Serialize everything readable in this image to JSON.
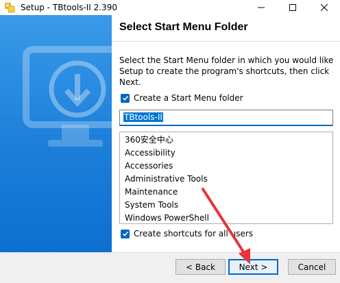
{
  "window": {
    "title": "Setup - TBtools-II 2.390"
  },
  "page": {
    "heading": "Select Start Menu Folder",
    "description_lines": [
      "Select the Start Menu folder in which you would like",
      "Setup to create the program's shortcuts, then click",
      "Next."
    ]
  },
  "create_folder": {
    "label": "Create a Start Menu folder",
    "checked": true
  },
  "folder_input": {
    "value": "TBtools-II"
  },
  "folder_list": [
    "360安全中心",
    "Accessibility",
    "Accessories",
    "Administrative Tools",
    "Maintenance",
    "System Tools",
    "Windows PowerShell"
  ],
  "all_users": {
    "label": "Create shortcuts for all users",
    "checked": true
  },
  "buttons": {
    "back": "< Back",
    "next": "Next >",
    "cancel": "Cancel"
  },
  "colors": {
    "accent": "#0067c0",
    "banner": "#1c7fda",
    "selection": "#0078d7",
    "arrow": "#e8343a"
  },
  "icons": {
    "app": "tbtools-app-icon",
    "banner": "monitor-download-icon"
  }
}
